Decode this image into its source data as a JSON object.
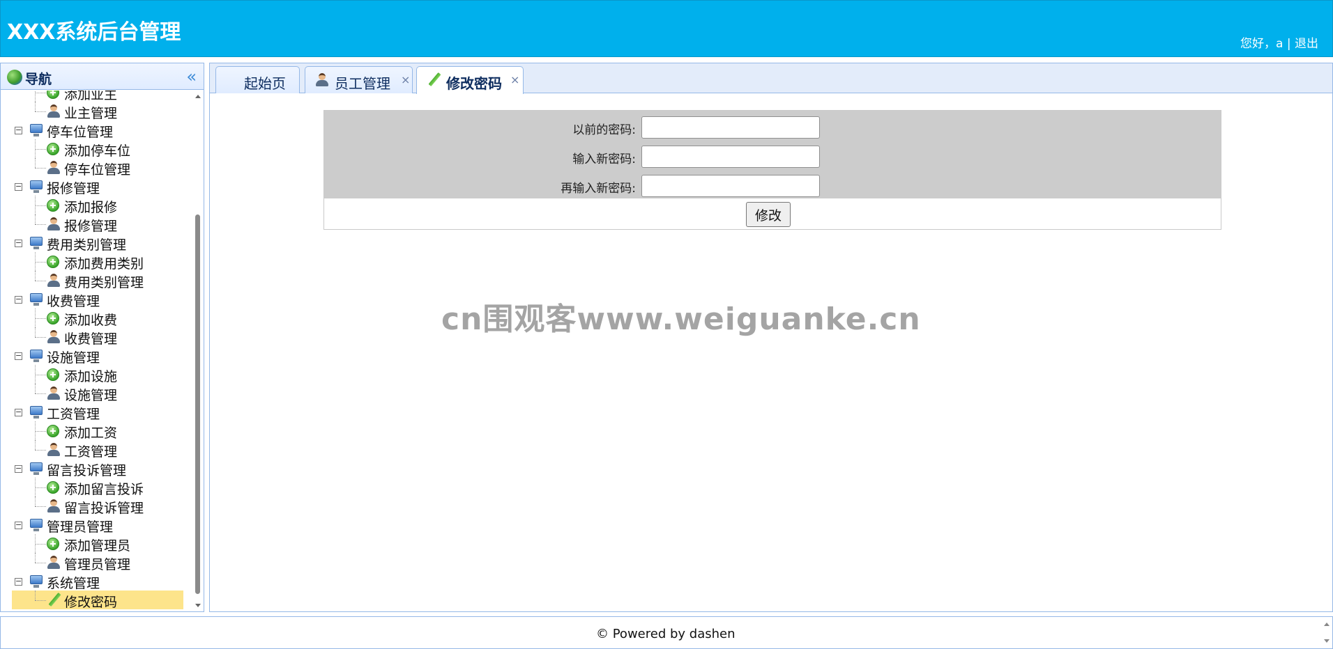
{
  "header": {
    "title": "XXX系统后台管理",
    "greeting": "您好，",
    "username": "a",
    "separator": "|",
    "logout": "退出"
  },
  "sidebar": {
    "title": "导航",
    "collapse_icon": "«",
    "tree": [
      {
        "label": "添加业主",
        "type": "add"
      },
      {
        "label": "业主管理",
        "type": "manage"
      },
      {
        "label": "停车位管理",
        "type": "group"
      },
      {
        "label": "添加停车位",
        "type": "add"
      },
      {
        "label": "停车位管理",
        "type": "manage"
      },
      {
        "label": "报修管理",
        "type": "group"
      },
      {
        "label": "添加报修",
        "type": "add"
      },
      {
        "label": "报修管理",
        "type": "manage"
      },
      {
        "label": "费用类别管理",
        "type": "group"
      },
      {
        "label": "添加费用类别",
        "type": "add"
      },
      {
        "label": "费用类别管理",
        "type": "manage"
      },
      {
        "label": "收费管理",
        "type": "group"
      },
      {
        "label": "添加收费",
        "type": "add"
      },
      {
        "label": "收费管理",
        "type": "manage"
      },
      {
        "label": "设施管理",
        "type": "group"
      },
      {
        "label": "添加设施",
        "type": "add"
      },
      {
        "label": "设施管理",
        "type": "manage"
      },
      {
        "label": "工资管理",
        "type": "group"
      },
      {
        "label": "添加工资",
        "type": "add"
      },
      {
        "label": "工资管理",
        "type": "manage"
      },
      {
        "label": "留言投诉管理",
        "type": "group"
      },
      {
        "label": "添加留言投诉",
        "type": "add"
      },
      {
        "label": "留言投诉管理",
        "type": "manage"
      },
      {
        "label": "管理员管理",
        "type": "group"
      },
      {
        "label": "添加管理员",
        "type": "add"
      },
      {
        "label": "管理员管理",
        "type": "manage"
      },
      {
        "label": "系统管理",
        "type": "group"
      },
      {
        "label": "修改密码",
        "type": "edit",
        "selected": true
      }
    ]
  },
  "tabs": [
    {
      "label": "起始页",
      "closable": false,
      "active": false
    },
    {
      "label": "员工管理",
      "closable": true,
      "active": false
    },
    {
      "label": "修改密码",
      "closable": true,
      "active": true
    }
  ],
  "tab_close_glyph": "×",
  "form": {
    "old_password_label": "以前的密码:",
    "old_password_value": "",
    "new_password_label": "输入新密码:",
    "new_password_value": "",
    "confirm_password_label": "再输入新密码:",
    "confirm_password_value": "",
    "submit_label": "修改"
  },
  "watermark": "cn围观客www.weiguanke.cn",
  "footer": {
    "text": "© Powered by dashen"
  },
  "colors": {
    "header_bg": "#00b0ec",
    "selected_row": "#fde48b",
    "form_bg": "#cccccc",
    "panel_border": "#95b8e7"
  }
}
